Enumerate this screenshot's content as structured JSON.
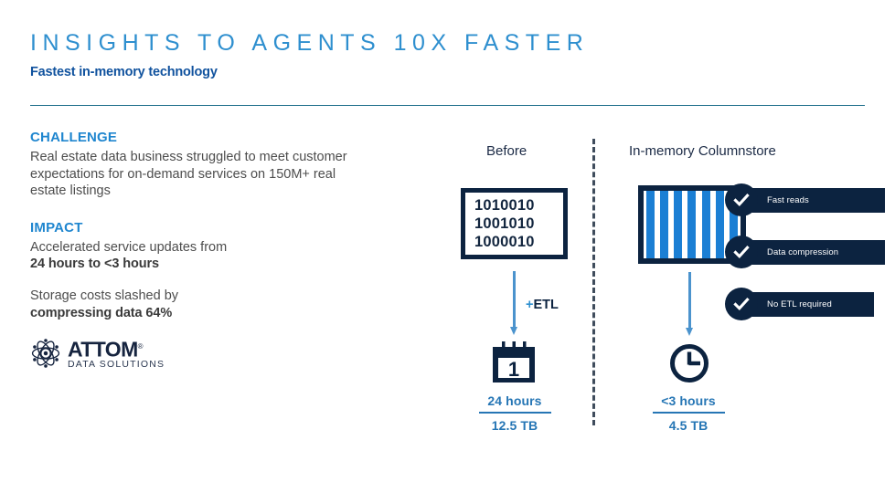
{
  "header": {
    "title": "INSIGHTS TO AGENTS 10X FASTER",
    "subtitle": "Fastest in-memory technology"
  },
  "left": {
    "challenge_heading": "CHALLENGE",
    "challenge_body": "Real estate data business struggled to meet customer expectations for on-demand services on 150M+ real estate listings",
    "impact_heading": "IMPACT",
    "impact_line1": "Accelerated service updates from",
    "impact_line2": "24 hours to  <3 hours",
    "impact_line3": "Storage costs slashed by",
    "impact_line4": "compressing data 64%"
  },
  "logo": {
    "name": "ATTOM",
    "registered": "®",
    "tagline": "DATA SOLUTIONS"
  },
  "before": {
    "column_title": "Before",
    "binary": [
      "1010010",
      "1001010",
      "1000010"
    ],
    "etl_plus": "+",
    "etl_label": "ETL",
    "calendar_day": "1",
    "metric_time": "24 hours",
    "metric_size": "12.5 TB"
  },
  "after": {
    "column_title": "In-memory Columnstore",
    "column_bars": 7,
    "benefits": [
      {
        "label": "Fast reads",
        "icon": "check-icon"
      },
      {
        "label": "Data compression",
        "icon": "check-icon"
      },
      {
        "label": "No ETL required",
        "icon": "check-icon"
      }
    ],
    "metric_time": "<3 hours",
    "metric_size": "4.5 TB"
  },
  "colors": {
    "title_blue": "#2e8fcf",
    "subtitle_blue": "#10529e",
    "navy": "#0c2340",
    "bar_blue": "#1b7fd4",
    "metric_blue": "#2676b5",
    "rule_teal": "#1f6f8b",
    "divider_gray": "#3f4c5c"
  }
}
